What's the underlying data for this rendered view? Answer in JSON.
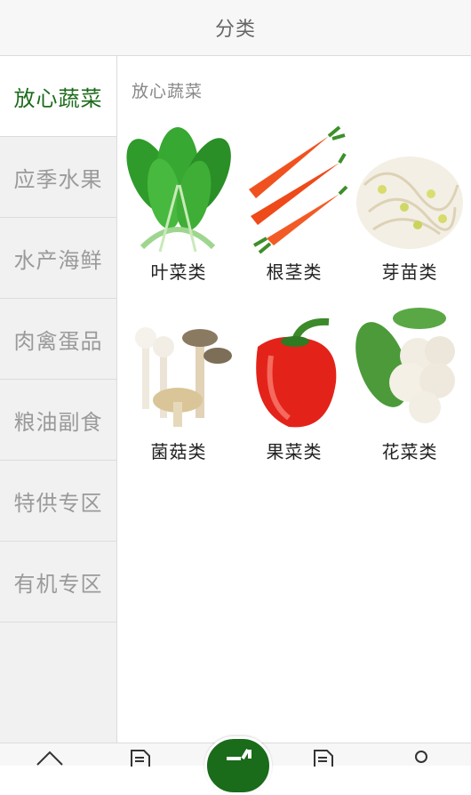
{
  "header": {
    "title": "分类"
  },
  "sidebar": {
    "items": [
      {
        "label": "放心蔬菜",
        "active": true
      },
      {
        "label": "应季水果",
        "active": false
      },
      {
        "label": "水产海鲜",
        "active": false
      },
      {
        "label": "肉禽蛋品",
        "active": false
      },
      {
        "label": "粮油副食",
        "active": false
      },
      {
        "label": "特供专区",
        "active": false
      },
      {
        "label": "有机专区",
        "active": false
      }
    ]
  },
  "content": {
    "section_title": "放心蔬菜",
    "tiles": [
      {
        "label": "叶菜类",
        "image": "leafy-greens"
      },
      {
        "label": "根茎类",
        "image": "carrots"
      },
      {
        "label": "芽苗类",
        "image": "bean-sprouts"
      },
      {
        "label": "菌菇类",
        "image": "mushrooms"
      },
      {
        "label": "果菜类",
        "image": "red-bell-pepper"
      },
      {
        "label": "花菜类",
        "image": "cauliflower"
      }
    ]
  },
  "tabbar": {
    "icons": [
      "home-icon",
      "document-icon",
      "center-action-icon",
      "document-icon",
      "user-icon"
    ]
  },
  "colors": {
    "accent_green": "#1c6b1c",
    "sidebar_bg": "#f1f1f1",
    "inactive_text": "#9a9a9a"
  }
}
